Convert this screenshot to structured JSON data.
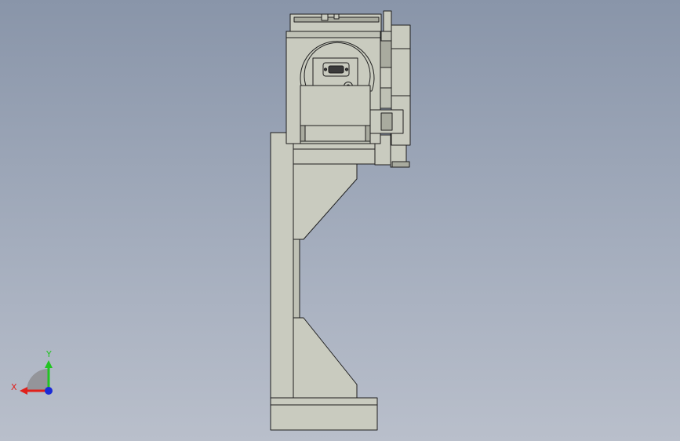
{
  "viewport": {
    "background_top": "#8995a9",
    "background_bottom": "#b9bfcb",
    "part_fill": "#c9cbbf",
    "part_fill_dark": "#a9ab9f",
    "edge_color": "#1e1e1e"
  },
  "triad": {
    "x_label": "X",
    "y_label": "Y",
    "x_color": "#e0201b",
    "y_color": "#22c422",
    "z_color": "#1a2bd6"
  }
}
